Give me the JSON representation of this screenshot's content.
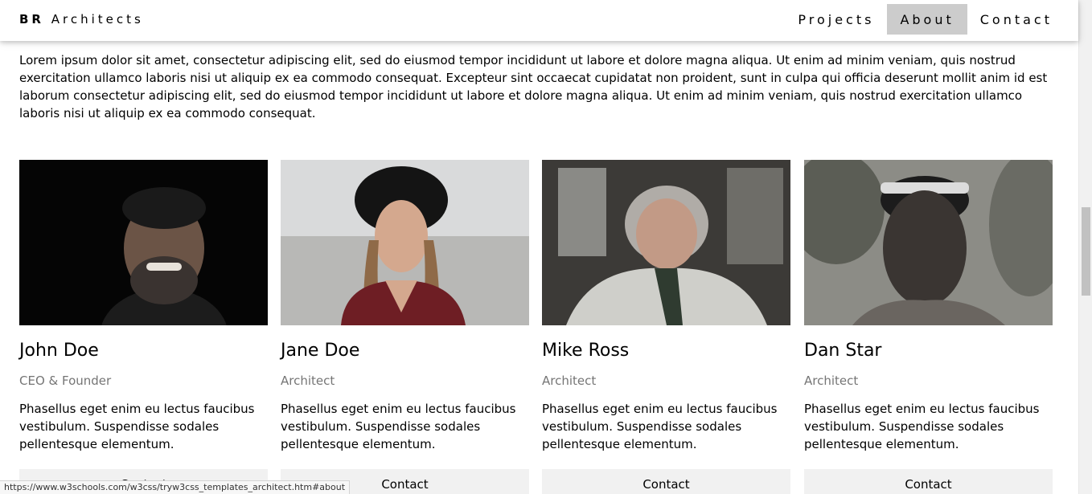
{
  "navbar": {
    "brand_bold": "BR",
    "brand_rest": "Architects",
    "links": [
      {
        "label": "Projects",
        "active": false
      },
      {
        "label": "About",
        "active": true
      },
      {
        "label": "Contact",
        "active": false
      }
    ]
  },
  "intro_text": "Lorem ipsum dolor sit amet, consectetur adipiscing elit, sed do eiusmod tempor incididunt ut labore et dolore magna aliqua. Ut enim ad minim veniam, quis nostrud exercitation ullamco laboris nisi ut aliquip ex ea commodo consequat. Excepteur sint occaecat cupidatat non proident, sunt in culpa qui officia deserunt mollit anim id est laborum consectetur adipiscing elit, sed do eiusmod tempor incididunt ut labore et dolore magna aliqua. Ut enim ad minim veniam, quis nostrud exercitation ullamco laboris nisi ut aliquip ex ea commodo consequat.",
  "team": [
    {
      "name": "John Doe",
      "role": "CEO & Founder",
      "description": "Phasellus eget enim eu lectus faucibus vestibulum. Suspendisse sodales pellentesque elementum.",
      "button": "Contact"
    },
    {
      "name": "Jane Doe",
      "role": "Architect",
      "description": "Phasellus eget enim eu lectus faucibus vestibulum. Suspendisse sodales pellentesque elementum.",
      "button": "Contact"
    },
    {
      "name": "Mike Ross",
      "role": "Architect",
      "description": "Phasellus eget enim eu lectus faucibus vestibulum. Suspendisse sodales pellentesque elementum.",
      "button": "Contact"
    },
    {
      "name": "Dan Star",
      "role": "Architect",
      "description": "Phasellus eget enim eu lectus faucibus vestibulum. Suspendisse sodales pellentesque elementum.",
      "button": "Contact"
    }
  ],
  "status_url": "https://www.w3schools.com/w3css/tryw3css_templates_architect.htm#about"
}
